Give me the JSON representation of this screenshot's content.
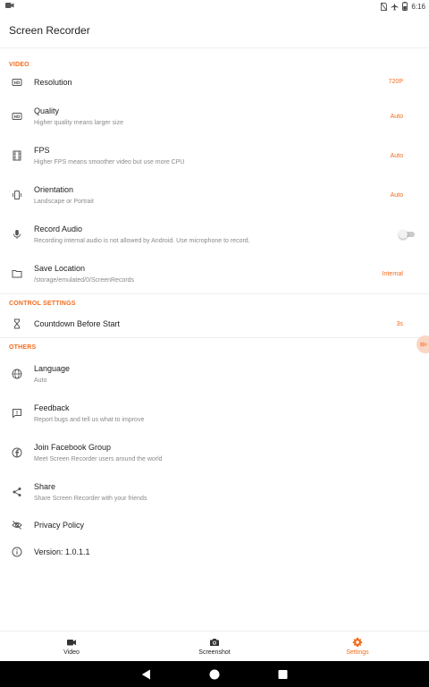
{
  "status_bar": {
    "time": "6:16",
    "left_icon": "screen-record-notification-icon",
    "icons": [
      "no-sim-icon",
      "airplane-mode-icon",
      "battery-icon"
    ]
  },
  "app": {
    "title": "Screen Recorder",
    "accent_color": "#f26b1d"
  },
  "sections": {
    "video": {
      "header": "VIDEO",
      "resolution": {
        "title": "Resolution",
        "value": "720P",
        "icon": "hd-icon"
      },
      "quality": {
        "title": "Quality",
        "subtitle": "Higher quality means larger size",
        "value": "Auto",
        "icon": "hd-icon"
      },
      "fps": {
        "title": "FPS",
        "subtitle": "Higher FPS means smoother video but use more CPU",
        "value": "Auto",
        "icon": "film-strip-icon"
      },
      "orientation": {
        "title": "Orientation",
        "subtitle": "Landscape or Portrait",
        "value": "Auto",
        "icon": "screen-rotation-icon"
      },
      "record_audio": {
        "title": "Record Audio",
        "subtitle": "Recording internal audio is not allowed by Android. Use microphone to record.",
        "enabled": false,
        "icon": "microphone-icon"
      },
      "save_location": {
        "title": "Save Location",
        "subtitle": "/storage/emulated/0/ScreenRecords",
        "value": "Internal",
        "icon": "folder-icon"
      }
    },
    "control": {
      "header": "CONTROL SETTINGS",
      "countdown": {
        "title": "Countdown Before Start",
        "value": "3s",
        "icon": "hourglass-icon"
      }
    },
    "others": {
      "header": "OTHERS",
      "language": {
        "title": "Language",
        "subtitle": "Auto",
        "icon": "globe-icon"
      },
      "feedback": {
        "title": "Feedback",
        "subtitle": "Report bugs and tell us what to improve",
        "icon": "feedback-icon"
      },
      "facebook": {
        "title": "Join Facebook Group",
        "subtitle": "Meet Screen Recorder users around the world",
        "icon": "facebook-icon"
      },
      "share": {
        "title": "Share",
        "subtitle": "Share Screen Recorder with your friends",
        "icon": "share-icon"
      },
      "privacy": {
        "title": "Privacy Policy",
        "icon": "eye-off-icon"
      },
      "version": {
        "title": "Version: 1.0.1.1",
        "icon": "info-icon"
      }
    }
  },
  "bottom_nav": {
    "items": [
      {
        "label": "Video",
        "icon": "videocam-icon",
        "active": false
      },
      {
        "label": "Screenshot",
        "icon": "camera-icon",
        "active": false
      },
      {
        "label": "Settings",
        "icon": "gear-icon",
        "active": true
      }
    ]
  },
  "system_nav": {
    "icons": [
      "back-icon",
      "home-icon",
      "recents-icon"
    ]
  }
}
